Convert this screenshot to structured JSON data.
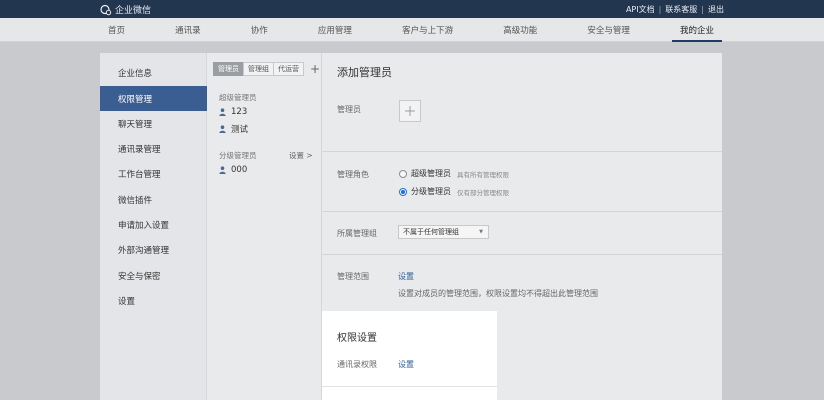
{
  "topbar": {
    "brand": "企业微信",
    "links": [
      "API文档",
      "联系客服",
      "退出"
    ]
  },
  "nav": {
    "items": [
      "首页",
      "通讯录",
      "协作",
      "应用管理",
      "客户与上下游",
      "高级功能",
      "安全与管理",
      "我的企业"
    ],
    "active_index": 7
  },
  "sidebar": {
    "items": [
      "企业信息",
      "权限管理",
      "聊天管理",
      "通讯录管理",
      "工作台管理",
      "微信插件",
      "申请加入设置",
      "外部沟通管理",
      "安全与保密",
      "设置"
    ],
    "active_index": 1
  },
  "midcol": {
    "tabs": [
      "管理员",
      "管理组",
      "代运营"
    ],
    "active_tab": 0,
    "add_symbol": "+",
    "super_admin_label": "超级管理员",
    "super_admins": [
      "123",
      "测试"
    ],
    "branch_admin_label": "分级管理员",
    "branch_settings": "设置 >",
    "branch_admins": [
      "000"
    ]
  },
  "content": {
    "title": "添加管理员",
    "admin_label": "管理员",
    "role_label": "管理角色",
    "roles": [
      {
        "name": "超级管理员",
        "desc": "具有所有管理权限",
        "checked": false
      },
      {
        "name": "分级管理员",
        "desc": "仅有部分管理权限",
        "checked": true
      }
    ],
    "group_label": "所属管理组",
    "group_select": "不属于任何管理组",
    "scope_label": "管理范围",
    "scope_link": "设置",
    "scope_help": "设置对成员的管理范围，权限设置均不得超出此管理范围"
  },
  "popup": {
    "title": "权限设置",
    "label": "通讯录权限",
    "link": "设置"
  },
  "colors": {
    "topbar": "#22364f",
    "active_sidebar": "#3a5e91",
    "link": "#2c5c97",
    "radio_checked": "#1a73d9"
  }
}
